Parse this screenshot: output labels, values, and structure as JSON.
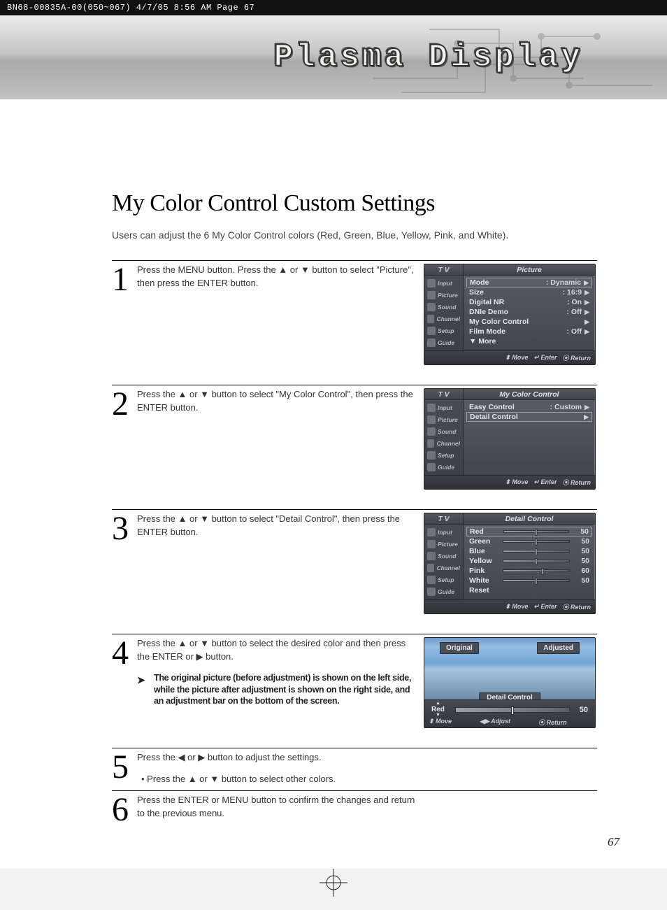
{
  "print_header": "BN68-00835A-00(050~067)  4/7/05  8:56 AM  Page 67",
  "banner_title": "Plasma Display",
  "section_title": "My Color Control Custom Settings",
  "intro": "Users can adjust the 6 My Color Control colors (Red, Green, Blue, Yellow, Pink, and White).",
  "page_number": "67",
  "sidebar_items": [
    "Input",
    "Picture",
    "Sound",
    "Channel",
    "Setup",
    "Guide"
  ],
  "steps": [
    {
      "num": "1",
      "text": "Press the MENU button. Press the ▲ or ▼ button to select \"Picture\", then press the ENTER button.",
      "menu": {
        "tv": "T V",
        "title": "Picture",
        "rows": [
          {
            "label": "Mode",
            "value": ": Dynamic",
            "selected": true
          },
          {
            "label": "Size",
            "value": ": 16:9"
          },
          {
            "label": "Digital NR",
            "value": ": On"
          },
          {
            "label": "DNIe Demo",
            "value": ": Off"
          },
          {
            "label": "My Color Control",
            "value": ""
          },
          {
            "label": "Film Mode",
            "value": ": Off"
          },
          {
            "label": "▼ More",
            "value": "",
            "noarrow": true
          }
        ],
        "foot": [
          "Move",
          "Enter",
          "Return"
        ]
      }
    },
    {
      "num": "2",
      "text": "Press the ▲ or ▼ button to select \"My Color Control\", then press the ENTER button.",
      "menu": {
        "tv": "T V",
        "title": "My Color Control",
        "rows": [
          {
            "label": "Easy Control",
            "value": ": Custom"
          },
          {
            "label": "Detail Control",
            "value": "",
            "selected": true
          }
        ],
        "foot": [
          "Move",
          "Enter",
          "Return"
        ]
      }
    },
    {
      "num": "3",
      "text": "Press the ▲ or ▼ button to select \"Detail Control\", then press the ENTER button.",
      "menu": {
        "tv": "T V",
        "title": "Detail Control",
        "sliders": [
          {
            "label": "Red",
            "value": "50",
            "pos": 50,
            "selected": true
          },
          {
            "label": "Green",
            "value": "50",
            "pos": 50
          },
          {
            "label": "Blue",
            "value": "50",
            "pos": 50
          },
          {
            "label": "Yellow",
            "value": "50",
            "pos": 50
          },
          {
            "label": "Pink",
            "value": "60",
            "pos": 60
          },
          {
            "label": "White",
            "value": "50",
            "pos": 50
          },
          {
            "label": "Reset",
            "value": "",
            "noslider": true
          }
        ],
        "foot": [
          "Move",
          "Enter",
          "Return"
        ]
      }
    },
    {
      "num": "4",
      "text": "Press the ▲ or ▼ button to select the desired color and then press the ENTER or ▶ button.",
      "note": "The original picture (before adjustment) is shown on the left side, while the picture after adjustment is shown on the right side, and an adjustment bar on the bottom of the screen.",
      "adjust": {
        "original": "Original",
        "adjusted": "Adjusted",
        "mid_label": "Detail Control",
        "color": "Red",
        "value": "50",
        "foot_move": "Move",
        "foot_adjust": "Adjust",
        "foot_return": "Return"
      }
    },
    {
      "num": "5",
      "text": "Press the ◀ or ▶ button to adjust the settings.",
      "bullet": "• Press the ▲ or ▼ button to select other colors."
    },
    {
      "num": "6",
      "text": "Press the ENTER or MENU button to confirm the changes and return to the previous menu."
    }
  ],
  "foot_glyphs": {
    "move": "⬍",
    "enter": "↵",
    "return": "⦿",
    "adjust": "◀▶"
  }
}
